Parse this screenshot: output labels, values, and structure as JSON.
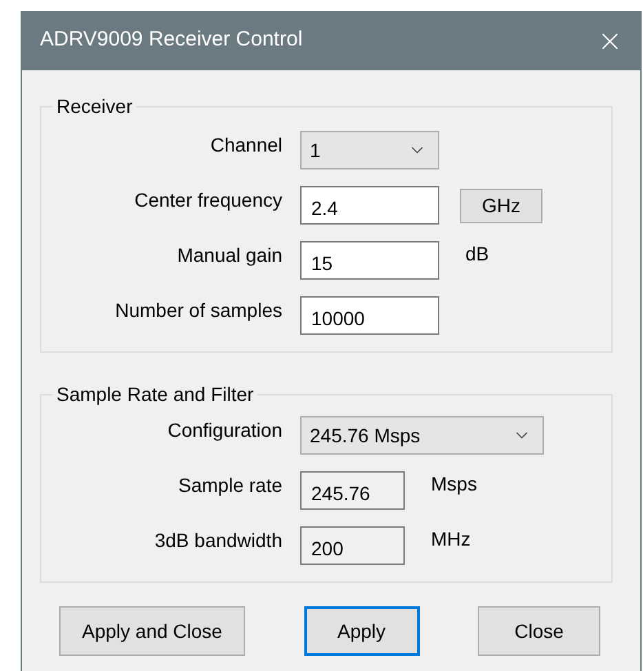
{
  "window": {
    "title": "ADRV9009 Receiver Control"
  },
  "groups": [
    {
      "title": "Receiver",
      "rows": [
        {
          "label": "Channel",
          "kind": "dropdown",
          "value": "1"
        },
        {
          "label": "Center frequency",
          "kind": "text",
          "value": "2.4",
          "unit": {
            "kind": "button",
            "text": "GHz"
          }
        },
        {
          "label": "Manual gain",
          "kind": "text",
          "value": "15",
          "unit": {
            "kind": "text",
            "text": "dB"
          }
        },
        {
          "label": "Number of samples",
          "kind": "text",
          "value": "10000"
        }
      ]
    },
    {
      "title": "Sample Rate and Filter",
      "rows": [
        {
          "label": "Configuration",
          "kind": "combobox",
          "value": "245.76 Msps"
        },
        {
          "label": "Sample rate",
          "kind": "readonly",
          "value": "245.76",
          "unit": {
            "kind": "text",
            "text": "Msps"
          }
        },
        {
          "label": "3dB bandwidth",
          "kind": "readonly",
          "value": "200",
          "unit": {
            "kind": "text",
            "text": "MHz"
          }
        }
      ]
    }
  ],
  "buttons": [
    {
      "label": "Apply and Close",
      "focused": false
    },
    {
      "label": "Apply",
      "focused": true
    },
    {
      "label": "Close",
      "focused": false
    }
  ]
}
